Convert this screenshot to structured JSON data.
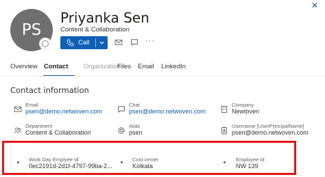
{
  "header": {
    "close_symbol": "✕",
    "avatar_initials": "PS",
    "name": "Priyanka Sen",
    "subtitle": "Content & Collaboration",
    "presence_status": "offline",
    "call_label": "Call",
    "more_symbol": "···"
  },
  "tabs": [
    {
      "label": "Overview",
      "state": "inactive"
    },
    {
      "label": "Contact",
      "state": "active"
    },
    {
      "label": "Organization",
      "state": "disabled"
    },
    {
      "label": "Files",
      "state": "inactive"
    },
    {
      "label": "Email",
      "state": "inactive"
    },
    {
      "label": "LinkedIn",
      "state": "inactive"
    }
  ],
  "contact": {
    "section_title": "Contact information",
    "email": {
      "label": "Email",
      "value": "psen@demo.netwoven.com",
      "icon": "mail-icon"
    },
    "chat": {
      "label": "Chat",
      "value": "psen@demo.netwoven.com",
      "icon": "chat-icon"
    },
    "company": {
      "label": "Company",
      "value": "Newtoven",
      "icon": "building-icon"
    },
    "department": {
      "label": "Department",
      "value": "Content & Collaboration",
      "icon": "people-icon"
    },
    "alias": {
      "label": "Alias",
      "value": "psen",
      "icon": "at-icon"
    },
    "username": {
      "label": "Username [UserPrincipalName]",
      "value": "psen@demo.netwoven.com",
      "icon": "id-badge-icon"
    }
  },
  "custom_fields": {
    "workday": {
      "label": "Work Day Emplyee Id",
      "value": "0ec2191d-2d1f-4797-99ba-2..."
    },
    "cost_center": {
      "label": "Cost center",
      "value": "Kolkata"
    },
    "employee_id": {
      "label": "Employee Id",
      "value": "NW 139"
    }
  },
  "colors": {
    "accent": "#0f5fb4",
    "link": "#0b5cad",
    "highlight": "#e3151a",
    "avatar_bg": "#6f6f6f"
  }
}
